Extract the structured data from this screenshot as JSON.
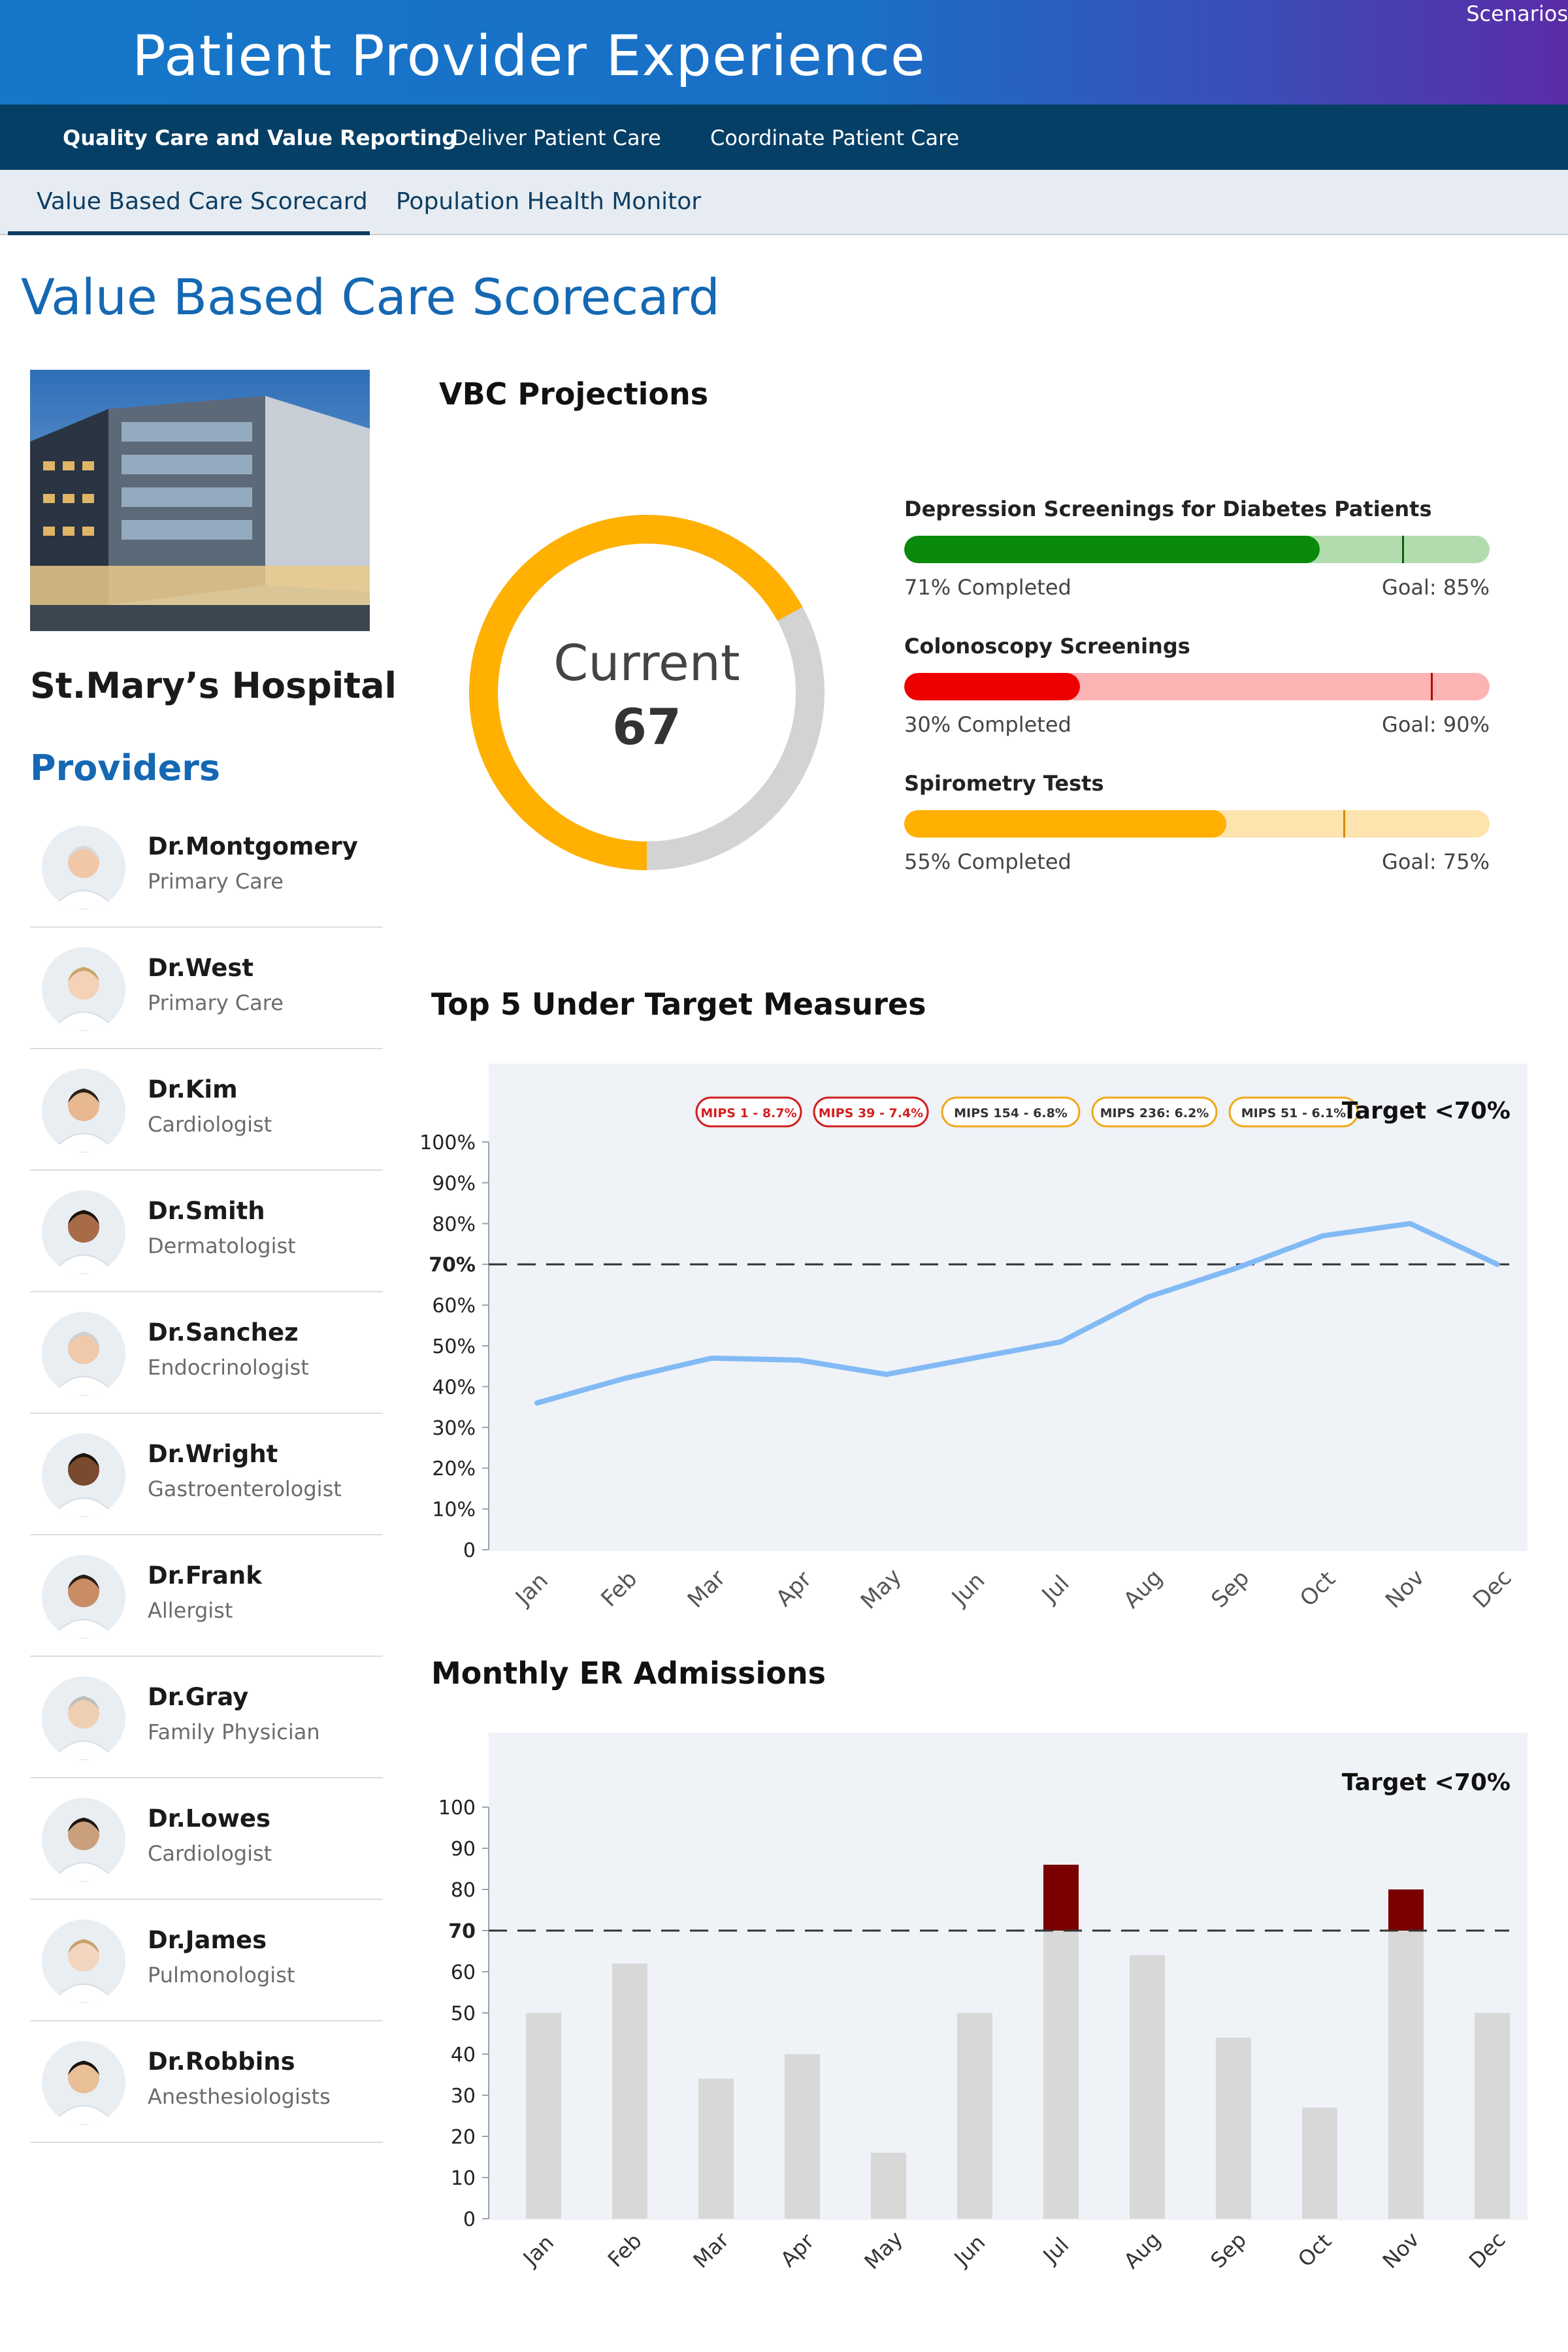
{
  "header": {
    "title": "Patient Provider Experience",
    "scenarios": "Scenarios"
  },
  "nav": {
    "main": [
      "Quality Care and Value Reporting",
      "Deliver Patient Care",
      "Coordinate Patient Care"
    ],
    "sub": [
      "Value Based Care Scorecard",
      "Population Health Monitor"
    ]
  },
  "page": {
    "title": "Value Based Care Scorecard"
  },
  "hospital": {
    "name": "St.Mary’s Hospital",
    "image": "hospital-building-photo"
  },
  "providers": {
    "title": "Providers",
    "list": [
      {
        "name": "Dr.Montgomery",
        "specialty": "Primary Care"
      },
      {
        "name": "Dr.West",
        "specialty": "Primary Care"
      },
      {
        "name": "Dr.Kim",
        "specialty": "Cardiologist"
      },
      {
        "name": "Dr.Smith",
        "specialty": "Dermatologist"
      },
      {
        "name": "Dr.Sanchez",
        "specialty": "Endocrinologist"
      },
      {
        "name": "Dr.Wright",
        "specialty": "Gastroenterologist"
      },
      {
        "name": "Dr.Frank",
        "specialty": "Allergist"
      },
      {
        "name": "Dr.Gray",
        "specialty": "Family Physician"
      },
      {
        "name": "Dr.Lowes",
        "specialty": "Cardiologist"
      },
      {
        "name": "Dr.James",
        "specialty": "Pulmonologist"
      },
      {
        "name": "Dr.Robbins",
        "specialty": "Anesthesiologists"
      }
    ]
  },
  "vbc": {
    "title": "VBC Projections",
    "gauge": {
      "label": "Current",
      "value": "67",
      "fraction": 0.67,
      "color": "#ffb000",
      "track": "#d3d3d3"
    },
    "bars": [
      {
        "title": "Depression Screenings for Diabetes Patients",
        "completed": "71% Completed",
        "goal": "Goal: 85%",
        "fraction": 0.71,
        "goal_fraction": 0.85,
        "fill": "#0a8a0a",
        "track": "#b2dcae",
        "marker": "#0b5c0b"
      },
      {
        "title": "Colonoscopy Screenings",
        "completed": "30% Completed",
        "goal": "Goal: 90%",
        "fraction": 0.3,
        "goal_fraction": 0.9,
        "fill": "#ee0000",
        "track": "#fbb3b3",
        "marker": "#b30000"
      },
      {
        "title": "Spirometry Tests",
        "completed": "55% Completed",
        "goal": "Goal: 75%",
        "fraction": 0.55,
        "goal_fraction": 0.75,
        "fill": "#ffb000",
        "track": "#fde3ad",
        "marker": "#d08a00"
      }
    ]
  },
  "measures": {
    "title": "Top 5 Under Target Measures",
    "target_label": "Target <70%",
    "badges": [
      {
        "text": "MIPS 1 - 8.7%",
        "color": "#d21f1f"
      },
      {
        "text": "MIPS 39 - 7.4%",
        "color": "#d21f1f"
      },
      {
        "text": "MIPS 154 - 6.8%",
        "color": "#f0a81c"
      },
      {
        "text": "MIPS 236: 6.2%",
        "color": "#f0a81c"
      },
      {
        "text": "MIPS 51 - 6.1%",
        "color": "#f0a81c"
      }
    ]
  },
  "er": {
    "title": "Monthly ER Admissions",
    "target_label": "Target <70%"
  },
  "chart_data": [
    {
      "type": "line",
      "categories": [
        "Jan",
        "Feb",
        "Mar",
        "Apr",
        "May",
        "Jun",
        "Jul",
        "Aug",
        "Sep",
        "Oct",
        "Nov",
        "Dec"
      ],
      "series": [
        {
          "values": [
            36,
            42,
            47,
            46.5,
            43,
            47,
            51,
            62,
            69,
            77,
            80,
            70
          ],
          "color": "#82baf5"
        }
      ],
      "y_ticks": [
        "0",
        "10%",
        "20%",
        "30%",
        "40%",
        "50%",
        "60%",
        "70%",
        "80%",
        "90%",
        "100%"
      ],
      "ylim": [
        0,
        100
      ],
      "target": 70,
      "grid": false
    },
    {
      "type": "bar",
      "categories": [
        "Jan",
        "Feb",
        "Mar",
        "Apr",
        "May",
        "Jun",
        "Jul",
        "Aug",
        "Sep",
        "Oct",
        "Nov",
        "Dec"
      ],
      "values": [
        50,
        62,
        34,
        40,
        16,
        50,
        86,
        64,
        44,
        27,
        80,
        50
      ],
      "y_ticks": [
        "0",
        "10",
        "20",
        "30",
        "40",
        "50",
        "60",
        "70",
        "80",
        "90",
        "100"
      ],
      "ylim": [
        0,
        100
      ],
      "target": 70,
      "bar_color": "#d8d8d8",
      "over_target_color": "#7a0000",
      "grid": false
    }
  ]
}
